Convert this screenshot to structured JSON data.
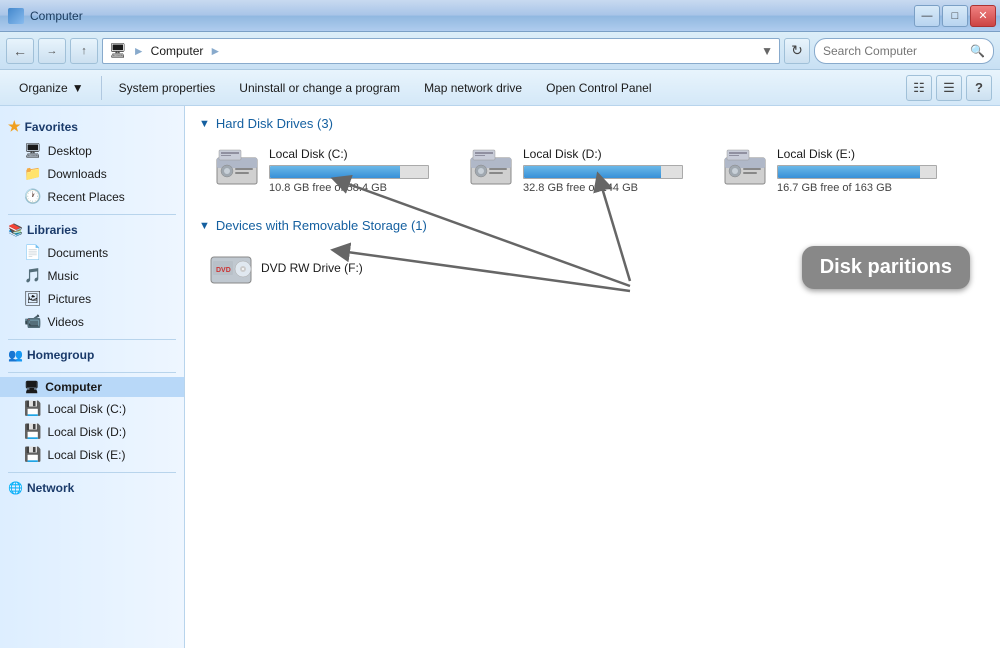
{
  "titlebar": {
    "title": "Computer",
    "min_label": "—",
    "max_label": "□",
    "close_label": "✕"
  },
  "addressbar": {
    "icon": "🖥",
    "path_1": "Computer",
    "path_2": "",
    "search_placeholder": "Search Computer"
  },
  "toolbar": {
    "organize_label": "Organize",
    "system_props_label": "System properties",
    "uninstall_label": "Uninstall or change a program",
    "map_drive_label": "Map network drive",
    "control_panel_label": "Open Control Panel"
  },
  "sidebar": {
    "favorites_label": "Favorites",
    "desktop_label": "Desktop",
    "downloads_label": "Downloads",
    "recent_label": "Recent Places",
    "libraries_label": "Libraries",
    "documents_label": "Documents",
    "music_label": "Music",
    "pictures_label": "Pictures",
    "videos_label": "Videos",
    "homegroup_label": "Homegroup",
    "computer_label": "Computer",
    "local_c_label": "Local Disk (C:)",
    "local_d_label": "Local Disk (D:)",
    "local_e_label": "Local Disk (E:)",
    "network_label": "Network"
  },
  "content": {
    "hard_disks_title": "Hard Disk Drives (3)",
    "removable_title": "Devices with Removable Storage (1)",
    "drives": [
      {
        "name": "Local Disk (C:)",
        "free": "10.8 GB free of 58.4 GB",
        "free_pct": 18,
        "total_pct": 82
      },
      {
        "name": "Local Disk (D:)",
        "free": "32.8 GB free of 244 GB",
        "free_pct": 13,
        "total_pct": 87
      },
      {
        "name": "Local Disk (E:)",
        "free": "16.7 GB free of 163 GB",
        "free_pct": 10,
        "total_pct": 90
      }
    ],
    "dvd_name": "DVD RW Drive (F:)"
  },
  "annotation": {
    "label": "Disk paritions"
  }
}
